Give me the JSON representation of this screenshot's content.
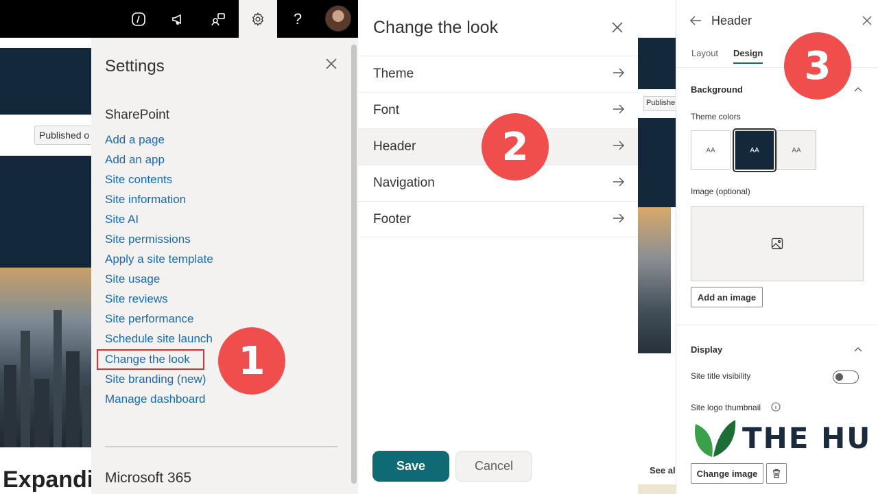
{
  "background_page": {
    "published_tag": "Published o",
    "page_title": "Expandir",
    "slice_published_tag": "Publishe",
    "see_all": "See all"
  },
  "topbar": {
    "icons": [
      "code-icon",
      "megaphone-icon",
      "people-chat-icon",
      "gear-icon",
      "help-icon"
    ],
    "help_glyph": "?"
  },
  "settings": {
    "title": "Settings",
    "section_sharepoint": "SharePoint",
    "links": [
      "Add a page",
      "Add an app",
      "Site contents",
      "Site information",
      "Site AI",
      "Site permissions",
      "Apply a site template",
      "Site usage",
      "Site reviews",
      "Site performance",
      "Schedule site launch",
      "Change the look",
      "Site branding (new)",
      "Manage dashboard"
    ],
    "section_m365": "Microsoft 365"
  },
  "badges": {
    "one": "1",
    "two": "2",
    "three": "3"
  },
  "change_the_look": {
    "title": "Change the look",
    "items": [
      "Theme",
      "Font",
      "Header",
      "Navigation",
      "Footer"
    ],
    "active_item": "Header",
    "save": "Save",
    "cancel": "Cancel"
  },
  "header_panel": {
    "title": "Header",
    "tabs": [
      "Layout",
      "Design"
    ],
    "active_tab": "Design",
    "background_section": "Background",
    "theme_colors_label": "Theme colors",
    "swatch_glyph": "AA",
    "image_label": "Image (optional)",
    "add_image": "Add an image",
    "display_section": "Display",
    "site_title_visibility": "Site title visibility",
    "site_logo_thumbnail": "Site logo thumbnail",
    "logo_text": "THE HU",
    "change_image": "Change image"
  },
  "colors": {
    "accent": "#0f6b73",
    "link": "#1a6ab3",
    "badge": "#f04e4c",
    "navy": "#13283a"
  }
}
